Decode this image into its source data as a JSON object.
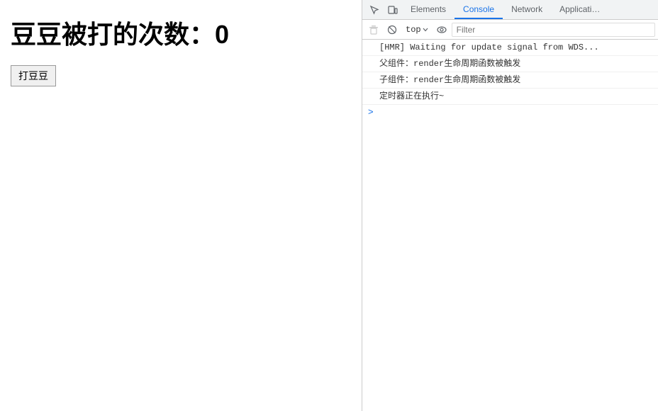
{
  "left": {
    "hit_count_label": "豆豆被打的次数：",
    "hit_count_value": "0",
    "button_label": "打豆豆"
  },
  "devtools": {
    "tabs": [
      {
        "id": "elements",
        "label": "Elements",
        "active": false
      },
      {
        "id": "console",
        "label": "Console",
        "active": true
      },
      {
        "id": "network",
        "label": "Network",
        "active": false
      },
      {
        "id": "application",
        "label": "Applicati…",
        "active": false
      }
    ],
    "toolbar": {
      "context_label": "top",
      "filter_placeholder": "Filter"
    },
    "console_lines": [
      {
        "id": "hmr",
        "text": "[HMR] Waiting for update signal from WDS..."
      },
      {
        "id": "parent-render",
        "text": "父组件：render生命周期函数被触发"
      },
      {
        "id": "child-render",
        "text": "子组件：render生命周期函数被触发"
      },
      {
        "id": "timer",
        "text": "定时器正在执行~"
      }
    ],
    "prompt_symbol": ">"
  }
}
